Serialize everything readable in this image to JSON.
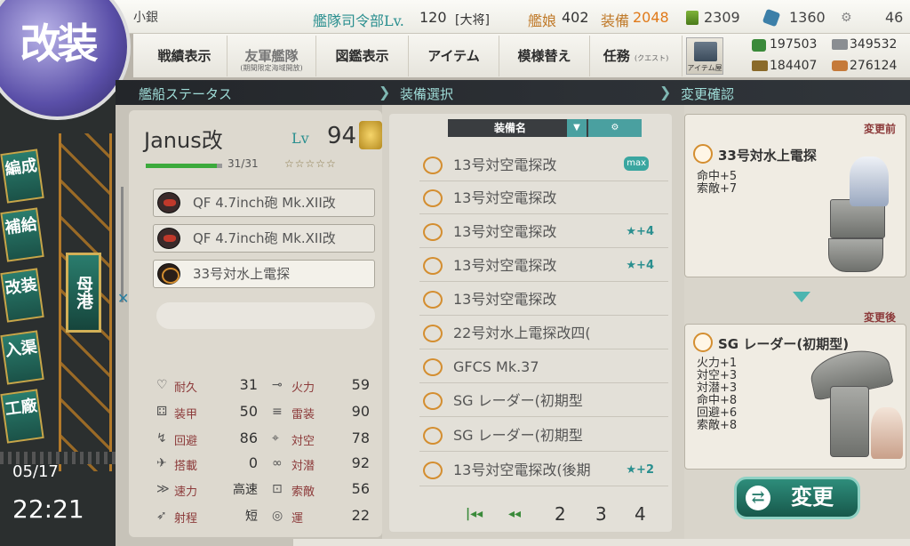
{
  "topbar": {
    "admiral_name": "小銀",
    "hq_label": "艦隊司令部Lv.",
    "hq_level": "120",
    "rank": "[大将]",
    "ships_label": "艦娘",
    "ships_count": "402",
    "equip_label": "装備",
    "equip_count": "2048",
    "bucket_count": "2309",
    "dev_count": "1360",
    "screw_count": "46"
  },
  "nav": {
    "items": [
      {
        "label": "戦績表示",
        "sub": ""
      },
      {
        "label": "友軍艦隊",
        "sub": "(期間限定海域開放)"
      },
      {
        "label": "図鑑表示",
        "sub": ""
      },
      {
        "label": "アイテム",
        "sub": ""
      },
      {
        "label": "模様替え",
        "sub": ""
      },
      {
        "label": "任務",
        "sub": "(クエスト)"
      }
    ],
    "shop_label": "アイテム屋"
  },
  "resources": {
    "fuel": "197503",
    "steel": "349532",
    "ammo": "184407",
    "bauxite": "276124"
  },
  "sidebar": {
    "kaisou_label": "改装",
    "items": [
      {
        "label": "編成"
      },
      {
        "label": "補給"
      },
      {
        "label": "改装"
      },
      {
        "label": "入渠"
      },
      {
        "label": "工廠"
      }
    ],
    "port_label": "母港",
    "date": "05/17",
    "time": "22:21"
  },
  "sections": {
    "status": "艦船ステータス",
    "select": "装備選択",
    "confirm": "変更確認"
  },
  "ship": {
    "name": "Janus改",
    "lv_label": "Lv",
    "level": "94",
    "hp": "31/31",
    "stars": "☆☆☆☆☆",
    "equipment": [
      {
        "name": "QF 4.7inch砲 Mk.XII改",
        "icon": "gun-icon"
      },
      {
        "name": "QF 4.7inch砲 Mk.XII改",
        "icon": "gun-icon"
      },
      {
        "name": "33号対水上電探",
        "icon": "radar-icon"
      }
    ],
    "stats_left": [
      {
        "label": "耐久",
        "value": "31",
        "icon": "heart-icon"
      },
      {
        "label": "装甲",
        "value": "50",
        "icon": "armor-icon"
      },
      {
        "label": "回避",
        "value": "86",
        "icon": "evasion-icon"
      },
      {
        "label": "搭載",
        "value": "0",
        "icon": "plane-icon"
      },
      {
        "label": "速力",
        "value": "高速",
        "icon": "speed-icon"
      },
      {
        "label": "射程",
        "value": "短",
        "icon": "range-icon"
      }
    ],
    "stats_right": [
      {
        "label": "火力",
        "value": "59",
        "icon": "firepower-icon"
      },
      {
        "label": "雷装",
        "value": "90",
        "icon": "torpedo-icon"
      },
      {
        "label": "対空",
        "value": "78",
        "icon": "aa-icon"
      },
      {
        "label": "対潜",
        "value": "92",
        "icon": "asw-icon"
      },
      {
        "label": "索敵",
        "value": "56",
        "icon": "los-icon"
      },
      {
        "label": "運",
        "value": "22",
        "icon": "luck-icon"
      }
    ]
  },
  "equip_list": {
    "header": "装備名",
    "rows": [
      {
        "name": "13号対空電探改",
        "tag": "max",
        "star": ""
      },
      {
        "name": "13号対空電探改",
        "tag": "",
        "star": ""
      },
      {
        "name": "13号対空電探改",
        "tag": "",
        "star": "★+4"
      },
      {
        "name": "13号対空電探改",
        "tag": "",
        "star": "★+4"
      },
      {
        "name": "13号対空電探改",
        "tag": "",
        "star": ""
      },
      {
        "name": "22号対水上電探改四(",
        "tag": "",
        "star": ""
      },
      {
        "name": "GFCS Mk.37",
        "tag": "",
        "star": ""
      },
      {
        "name": "SG レーダー(初期型",
        "tag": "",
        "star": ""
      },
      {
        "name": "SG レーダー(初期型",
        "tag": "",
        "star": ""
      },
      {
        "name": "13号対空電探改(後期",
        "tag": "",
        "star": "★+2"
      }
    ],
    "pages": [
      "2",
      "3",
      "4"
    ]
  },
  "confirm": {
    "before_label": "変更前",
    "before_name": "33号対水上電探",
    "before_stats": [
      "命中+5",
      "索敵+7"
    ],
    "after_label": "変更後",
    "after_name": "SG レーダー(初期型)",
    "after_stats": [
      "火力+1",
      "対空+3",
      "対潜+3",
      "命中+8",
      "回避+6",
      "索敵+8"
    ],
    "change_label": "変更"
  },
  "colors": {
    "accent_teal": "#2a8f8f",
    "equip_count_color": "#e07a1a",
    "stat_label": "#8c3a3a"
  }
}
